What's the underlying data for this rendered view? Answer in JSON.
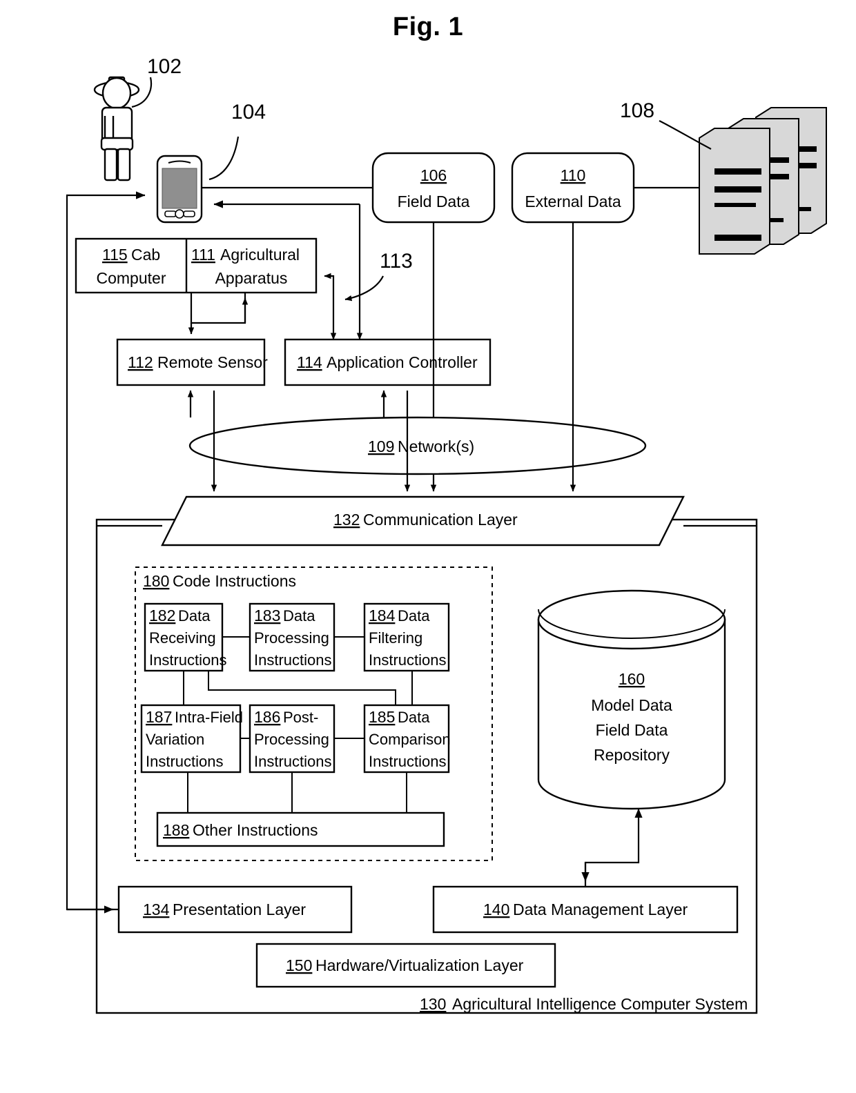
{
  "figure": {
    "title": "Fig. 1"
  },
  "lead_labels": {
    "user": "102",
    "device": "104",
    "server": "108",
    "apparatus_feed": "113"
  },
  "nodes": {
    "field_data": {
      "ref": "106",
      "label": "Field Data"
    },
    "external_data": {
      "ref": "110",
      "label": "External Data"
    },
    "cab_computer": {
      "ref": "115",
      "label": "Cab",
      "label2": "Computer"
    },
    "agricultural_apparatus": {
      "ref": "111",
      "label": "Agricultural",
      "label2": "Apparatus"
    },
    "remote_sensor": {
      "ref": "112",
      "label": "Remote Sensor"
    },
    "application_controller": {
      "ref": "114",
      "label": "Application Controller"
    },
    "network": {
      "ref": "109",
      "label": "Network(s)"
    },
    "communication_layer": {
      "ref": "132",
      "label": "Communication Layer"
    },
    "code_instructions": {
      "ref": "180",
      "label": "Code Instructions"
    },
    "repository": {
      "ref": "160",
      "line1": "Model Data",
      "line2": "Field Data",
      "line3": "Repository"
    },
    "presentation_layer": {
      "ref": "134",
      "label": "Presentation Layer"
    },
    "data_management_layer": {
      "ref": "140",
      "label": "Data Management Layer"
    },
    "hardware_layer": {
      "ref": "150",
      "label": "Hardware/Virtualization Layer"
    },
    "system": {
      "ref": "130",
      "label": "Agricultural Intelligence Computer System"
    }
  },
  "instruction_blocks": [
    {
      "ref": "182",
      "line1": "Data",
      "line2": "Receiving",
      "line3": "Instructions"
    },
    {
      "ref": "183",
      "line1": "Data",
      "line2": "Processing",
      "line3": "Instructions"
    },
    {
      "ref": "184",
      "line1": "Data",
      "line2": "Filtering",
      "line3": "Instructions"
    },
    {
      "ref": "187",
      "line1": " Intra-Field",
      "line2": "Variation",
      "line3": "Instructions"
    },
    {
      "ref": "186",
      "line1": "Post-",
      "line2": "Processing",
      "line3": "Instructions"
    },
    {
      "ref": "185",
      "line1": "Data",
      "line2": "Comparison",
      "line3": "Instructions"
    },
    {
      "ref": "188",
      "line1": " Other  Instructions",
      "line2": "",
      "line3": ""
    }
  ],
  "icons": {
    "user": "farmer-person-icon",
    "device": "mobile-phone-icon",
    "server": "server-rack-icon",
    "repository": "database-cylinder-icon"
  },
  "colors": {
    "stroke": "#000000",
    "background": "#ffffff",
    "screen": "#8f8f8f",
    "server_body": "#d8d8d8"
  }
}
